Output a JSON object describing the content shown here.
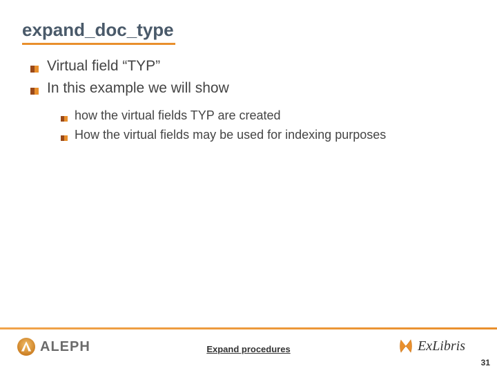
{
  "title": "expand_doc_type",
  "bullets_level1": [
    "Virtual field “TYP”",
    "In this example we will show"
  ],
  "bullets_level2": [
    "how the virtual fields TYP are created",
    "How the virtual fields may be used for indexing purposes"
  ],
  "footer": {
    "link_text": "Expand procedures",
    "page_number": "31",
    "aleph_label": "ALEPH",
    "exlibris_label": "ExLibris"
  }
}
